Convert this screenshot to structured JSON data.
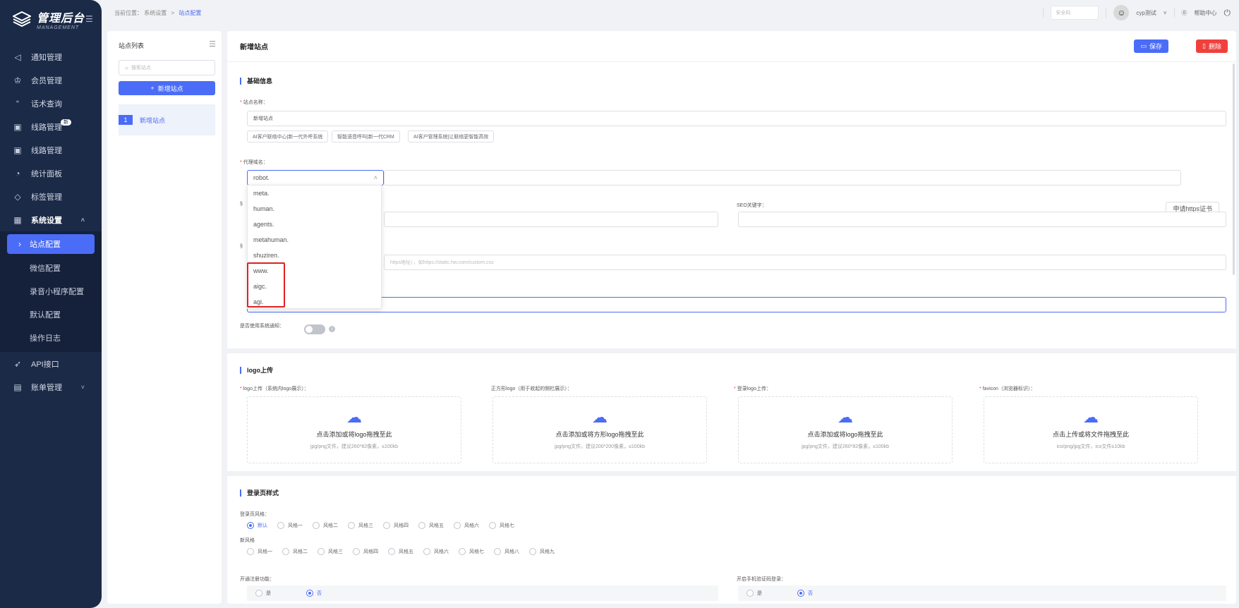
{
  "app": {
    "logo_title": "管理后台",
    "logo_sub": "MANAGEMENT"
  },
  "sidebar": {
    "items": [
      {
        "label": "通知管理",
        "icon": "megaphone-icon"
      },
      {
        "label": "会员管理",
        "icon": "member-icon"
      },
      {
        "label": "话术查询",
        "icon": "quote-icon"
      },
      {
        "label": "线路管理",
        "icon": "route-icon",
        "badge": "新"
      },
      {
        "label": "线路管理",
        "icon": "route-icon"
      },
      {
        "label": "统计面板",
        "icon": "chart-icon"
      },
      {
        "label": "标签管理",
        "icon": "tag-icon"
      }
    ],
    "group": {
      "label": "系统设置",
      "icon": "grid-icon"
    },
    "sub_items": [
      {
        "label": "站点配置",
        "active": true
      },
      {
        "label": "微信配置"
      },
      {
        "label": "录音小程序配置"
      },
      {
        "label": "默认配置"
      },
      {
        "label": "操作日志"
      }
    ],
    "after": [
      {
        "label": "API接口",
        "icon": "rocket-icon"
      },
      {
        "label": "账单管理",
        "icon": "bill-icon"
      }
    ]
  },
  "header": {
    "crumb_prefix": "当前位置：",
    "crumb_1": "系统设置",
    "crumb_sep": ">",
    "crumb_2": "站点配置",
    "security_placeholder": "安全码",
    "user": "cyp测试",
    "help": "帮助中心"
  },
  "left_panel": {
    "title": "站点列表",
    "search_placeholder": "搜索站点",
    "add_label": "新增站点",
    "site_num": "1",
    "site_label": "新增站点"
  },
  "main": {
    "title": "新增站点",
    "save": "保存",
    "delete": "删除",
    "basic_section": "基础信息",
    "site_name_label": "站点名称：",
    "site_name_value": "新增站点",
    "chips": [
      "AI客户联络中心|新一代外呼系统",
      "智能语音呼叫|新一代CRM",
      "AI客户管理系统|让联络更智能高效"
    ],
    "domain_label": "代理域名：",
    "domain_value": "robot.",
    "cert_button": "申请https证书",
    "seo_label": "SEO关键字：",
    "css_placeholder": "https地址），如https://static.hw.com/custom.css",
    "notify_label": "是否使用系统通知：",
    "dropdown_options": [
      "meta.",
      "human.",
      "agents.",
      "metahuman.",
      "shuziren.",
      "www.",
      "aigc.",
      "agi."
    ],
    "logo_section": "logo上传",
    "uploads": [
      {
        "label": "logo上传（系统内logo展示）：",
        "required": true,
        "t1": "点击添加或将logo拖拽至此",
        "t2": "jpg/png文件，建议260*82像素，≤100kb"
      },
      {
        "label": "正方形logo（用于收起的侧栏展示）：",
        "required": false,
        "t1": "点击添加或将方形logo拖拽至此",
        "t2": "jpg/png文件，建议200*200像素，≤100kb"
      },
      {
        "label": "登录logo上传：",
        "required": true,
        "t1": "点击添加或将logo拖拽至此",
        "t2": "jpg/png文件，建议260*82像素，≤100kb"
      },
      {
        "label": "favicon（浏览器标识）：",
        "required": true,
        "t1": "点击上传或将文件拖拽至此",
        "t2": "ico/png/jpg文件，ico文件≤10kb"
      }
    ],
    "login_section": "登录页样式",
    "login_style_label": "登录页风格：",
    "login_styles": [
      "默认",
      "风格一",
      "风格二",
      "风格三",
      "风格四",
      "风格五",
      "风格六",
      "风格七"
    ],
    "new_style_label": "新风格",
    "new_styles": [
      "风格一",
      "风格二",
      "风格三",
      "风格四",
      "风格五",
      "风格六",
      "风格七",
      "风格八",
      "风格九"
    ],
    "register_label": "开通注册功能：",
    "sms_login_label": "开启手机验证码登录：",
    "yes": "是",
    "no": "否"
  },
  "colors": {
    "sidebar": "#1b2a47",
    "accent": "#4a6cf7",
    "danger": "#f0403c",
    "highlight": "#e02020"
  }
}
